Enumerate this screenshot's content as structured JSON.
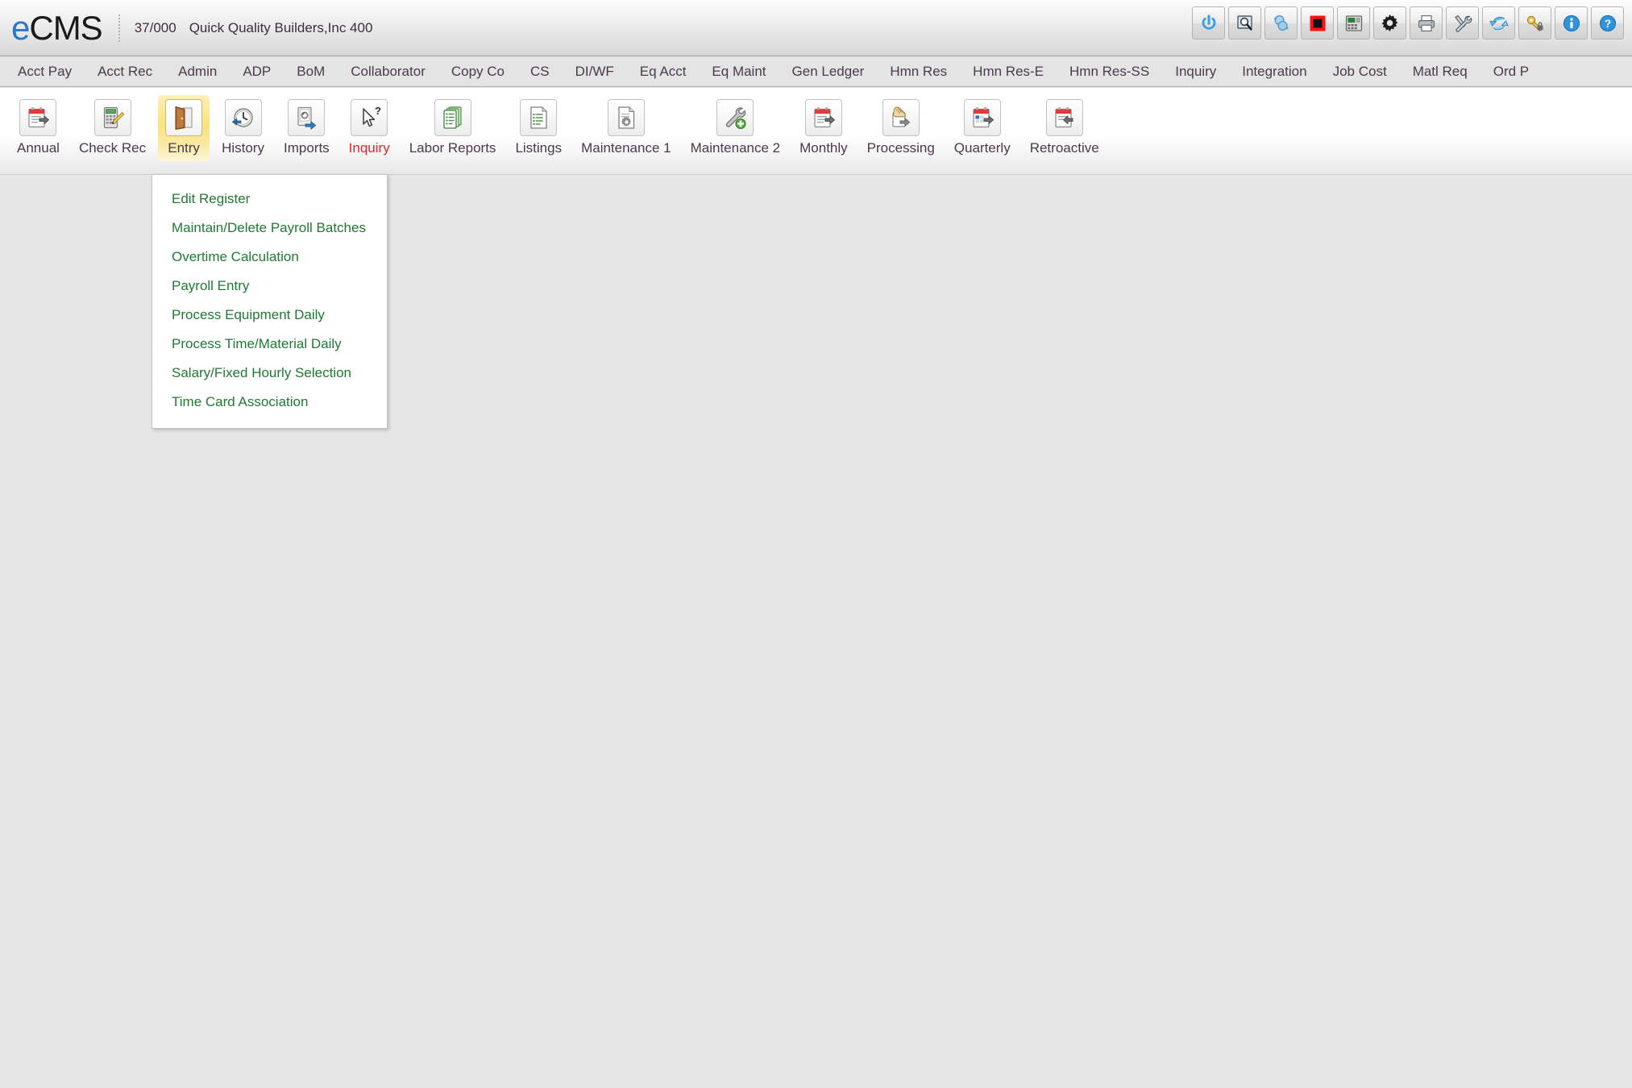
{
  "header": {
    "brand_prefix": "e",
    "brand_suffix": "CMS",
    "company_code": "37/000",
    "company_name": "Quick Quality Builders,Inc 400",
    "actions": [
      {
        "name": "power-icon",
        "title": "Power"
      },
      {
        "name": "search-screen-icon",
        "title": "Search"
      },
      {
        "name": "link-objects-icon",
        "title": "Links"
      },
      {
        "name": "stop-record-icon",
        "title": "Stop"
      },
      {
        "name": "calculator-icon",
        "title": "Calculator"
      },
      {
        "name": "gear-icon",
        "title": "Settings"
      },
      {
        "name": "printer-icon",
        "title": "Print"
      },
      {
        "name": "tools-icon",
        "title": "Tools"
      },
      {
        "name": "refresh-icon",
        "title": "Refresh"
      },
      {
        "name": "key-lock-icon",
        "title": "Security"
      },
      {
        "name": "info-icon",
        "title": "Information"
      },
      {
        "name": "help-icon",
        "title": "Help"
      }
    ]
  },
  "module_menu": {
    "items": [
      {
        "label": "Acct Pay"
      },
      {
        "label": "Acct Rec"
      },
      {
        "label": "Admin"
      },
      {
        "label": "ADP"
      },
      {
        "label": "BoM"
      },
      {
        "label": "Collaborator"
      },
      {
        "label": "Copy Co"
      },
      {
        "label": "CS"
      },
      {
        "label": "DI/WF"
      },
      {
        "label": "Eq Acct"
      },
      {
        "label": "Eq Maint"
      },
      {
        "label": "Gen Ledger"
      },
      {
        "label": "Hmn Res"
      },
      {
        "label": "Hmn Res-E"
      },
      {
        "label": "Hmn Res-SS"
      },
      {
        "label": "Inquiry"
      },
      {
        "label": "Integration"
      },
      {
        "label": "Job Cost"
      },
      {
        "label": "Matl Req"
      },
      {
        "label": "Ord P"
      }
    ]
  },
  "ribbon": {
    "buttons": [
      {
        "label": "Annual",
        "icon": "calendar-arrow-icon",
        "active": false,
        "alert": false
      },
      {
        "label": "Check Rec",
        "icon": "calculator-pencil-icon",
        "active": false,
        "alert": false
      },
      {
        "label": "Entry",
        "icon": "open-door-icon",
        "active": true,
        "alert": false
      },
      {
        "label": "History",
        "icon": "clock-arrow-icon",
        "active": false,
        "alert": false
      },
      {
        "label": "Imports",
        "icon": "import-page-icon",
        "active": false,
        "alert": false
      },
      {
        "label": "Inquiry",
        "icon": "cursor-question-icon",
        "active": false,
        "alert": true
      },
      {
        "label": "Labor Reports",
        "icon": "report-stack-icon",
        "active": false,
        "alert": false
      },
      {
        "label": "Listings",
        "icon": "list-page-icon",
        "active": false,
        "alert": false
      },
      {
        "label": "Maintenance 1",
        "icon": "page-gear-icon",
        "active": false,
        "alert": false
      },
      {
        "label": "Maintenance 2",
        "icon": "wrench-plus-icon",
        "active": false,
        "alert": false
      },
      {
        "label": "Monthly",
        "icon": "calendar-arrow-icon",
        "active": false,
        "alert": false
      },
      {
        "label": "Processing",
        "icon": "hand-page-icon",
        "active": false,
        "alert": false
      },
      {
        "label": "Quarterly",
        "icon": "calendar-grid-icon",
        "active": false,
        "alert": false
      },
      {
        "label": "Retroactive",
        "icon": "calendar-back-icon",
        "active": false,
        "alert": false
      }
    ]
  },
  "entry_dropdown": {
    "items": [
      {
        "label": "Edit Register"
      },
      {
        "label": "Maintain/Delete Payroll Batches"
      },
      {
        "label": "Overtime Calculation"
      },
      {
        "label": "Payroll Entry"
      },
      {
        "label": "Process Equipment Daily"
      },
      {
        "label": "Process Time/Material Daily"
      },
      {
        "label": "Salary/Fixed Hourly Selection"
      },
      {
        "label": "Time Card Association"
      }
    ]
  },
  "colors": {
    "brand_accent": "#2a79c4",
    "menu_text": "#4a3a4a",
    "dropdown_text": "#1f7a32",
    "alert_text": "#e4262c",
    "active_highlight": "#fbe27e",
    "workspace_bg": "#e6e6e6"
  }
}
